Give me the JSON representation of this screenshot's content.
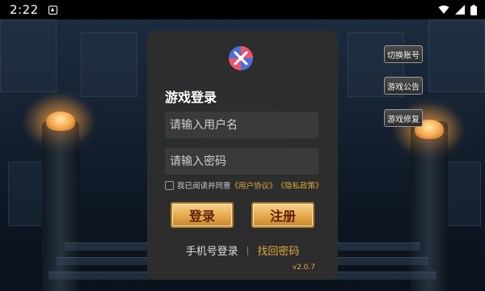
{
  "status_bar": {
    "time": "2:22",
    "icons": [
      "notification-icon",
      "wifi-icon",
      "signal-icon",
      "battery-icon"
    ]
  },
  "login_panel": {
    "logo_icon": "game-logo-icon",
    "title": "游戏登录",
    "username_placeholder": "请输入用户名",
    "username_value": "",
    "password_placeholder": "请输入密码",
    "password_value": "",
    "agreement": {
      "checked": false,
      "text": "我已阅读并同意",
      "user_agreement": "《用户协议》",
      "privacy_policy": "《隐私政策》"
    },
    "login_button": "登录",
    "register_button": "注册",
    "phone_login": "手机号登录",
    "separator": "|",
    "recover_password": "找回密码",
    "version": "v2.0.7"
  },
  "side_buttons": {
    "switch_account": "切换账号",
    "announcement": "游戏公告",
    "repair": "游戏修复"
  },
  "colors": {
    "accent_gold": "#e0a83a",
    "panel_bg": "#2e2e2e",
    "button_gold": "#e6a84b",
    "button_text": "#5b1f0c"
  }
}
